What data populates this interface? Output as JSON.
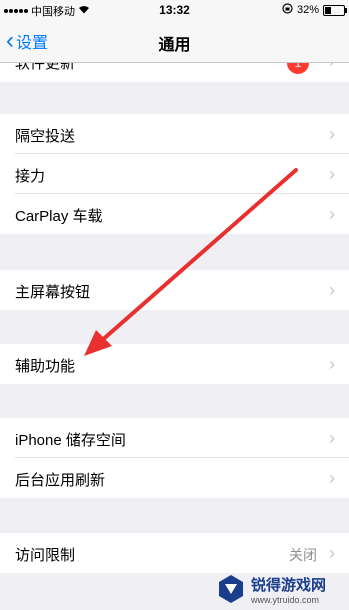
{
  "status_bar": {
    "carrier": "中国移动",
    "time": "13:32",
    "battery_percent": "32%",
    "battery_level": 0.32
  },
  "nav": {
    "back_label": "设置",
    "title": "通用"
  },
  "rows": {
    "software_update": {
      "label": "软件更新",
      "badge": "1"
    },
    "airdrop": {
      "label": "隔空投送"
    },
    "handoff": {
      "label": "接力"
    },
    "carplay": {
      "label": "CarPlay 车载"
    },
    "home_button": {
      "label": "主屏幕按钮"
    },
    "accessibility": {
      "label": "辅助功能"
    },
    "iphone_storage": {
      "label": "iPhone 储存空间"
    },
    "background_refresh": {
      "label": "后台应用刷新"
    },
    "restrictions": {
      "label": "访问限制",
      "value": "关闭"
    }
  },
  "watermark": {
    "name": "锐得游戏网",
    "url": "www.ytruido.com"
  },
  "colors": {
    "accent": "#007aff",
    "annotation_arrow": "#e8312f",
    "badge": "#ff3b30"
  }
}
